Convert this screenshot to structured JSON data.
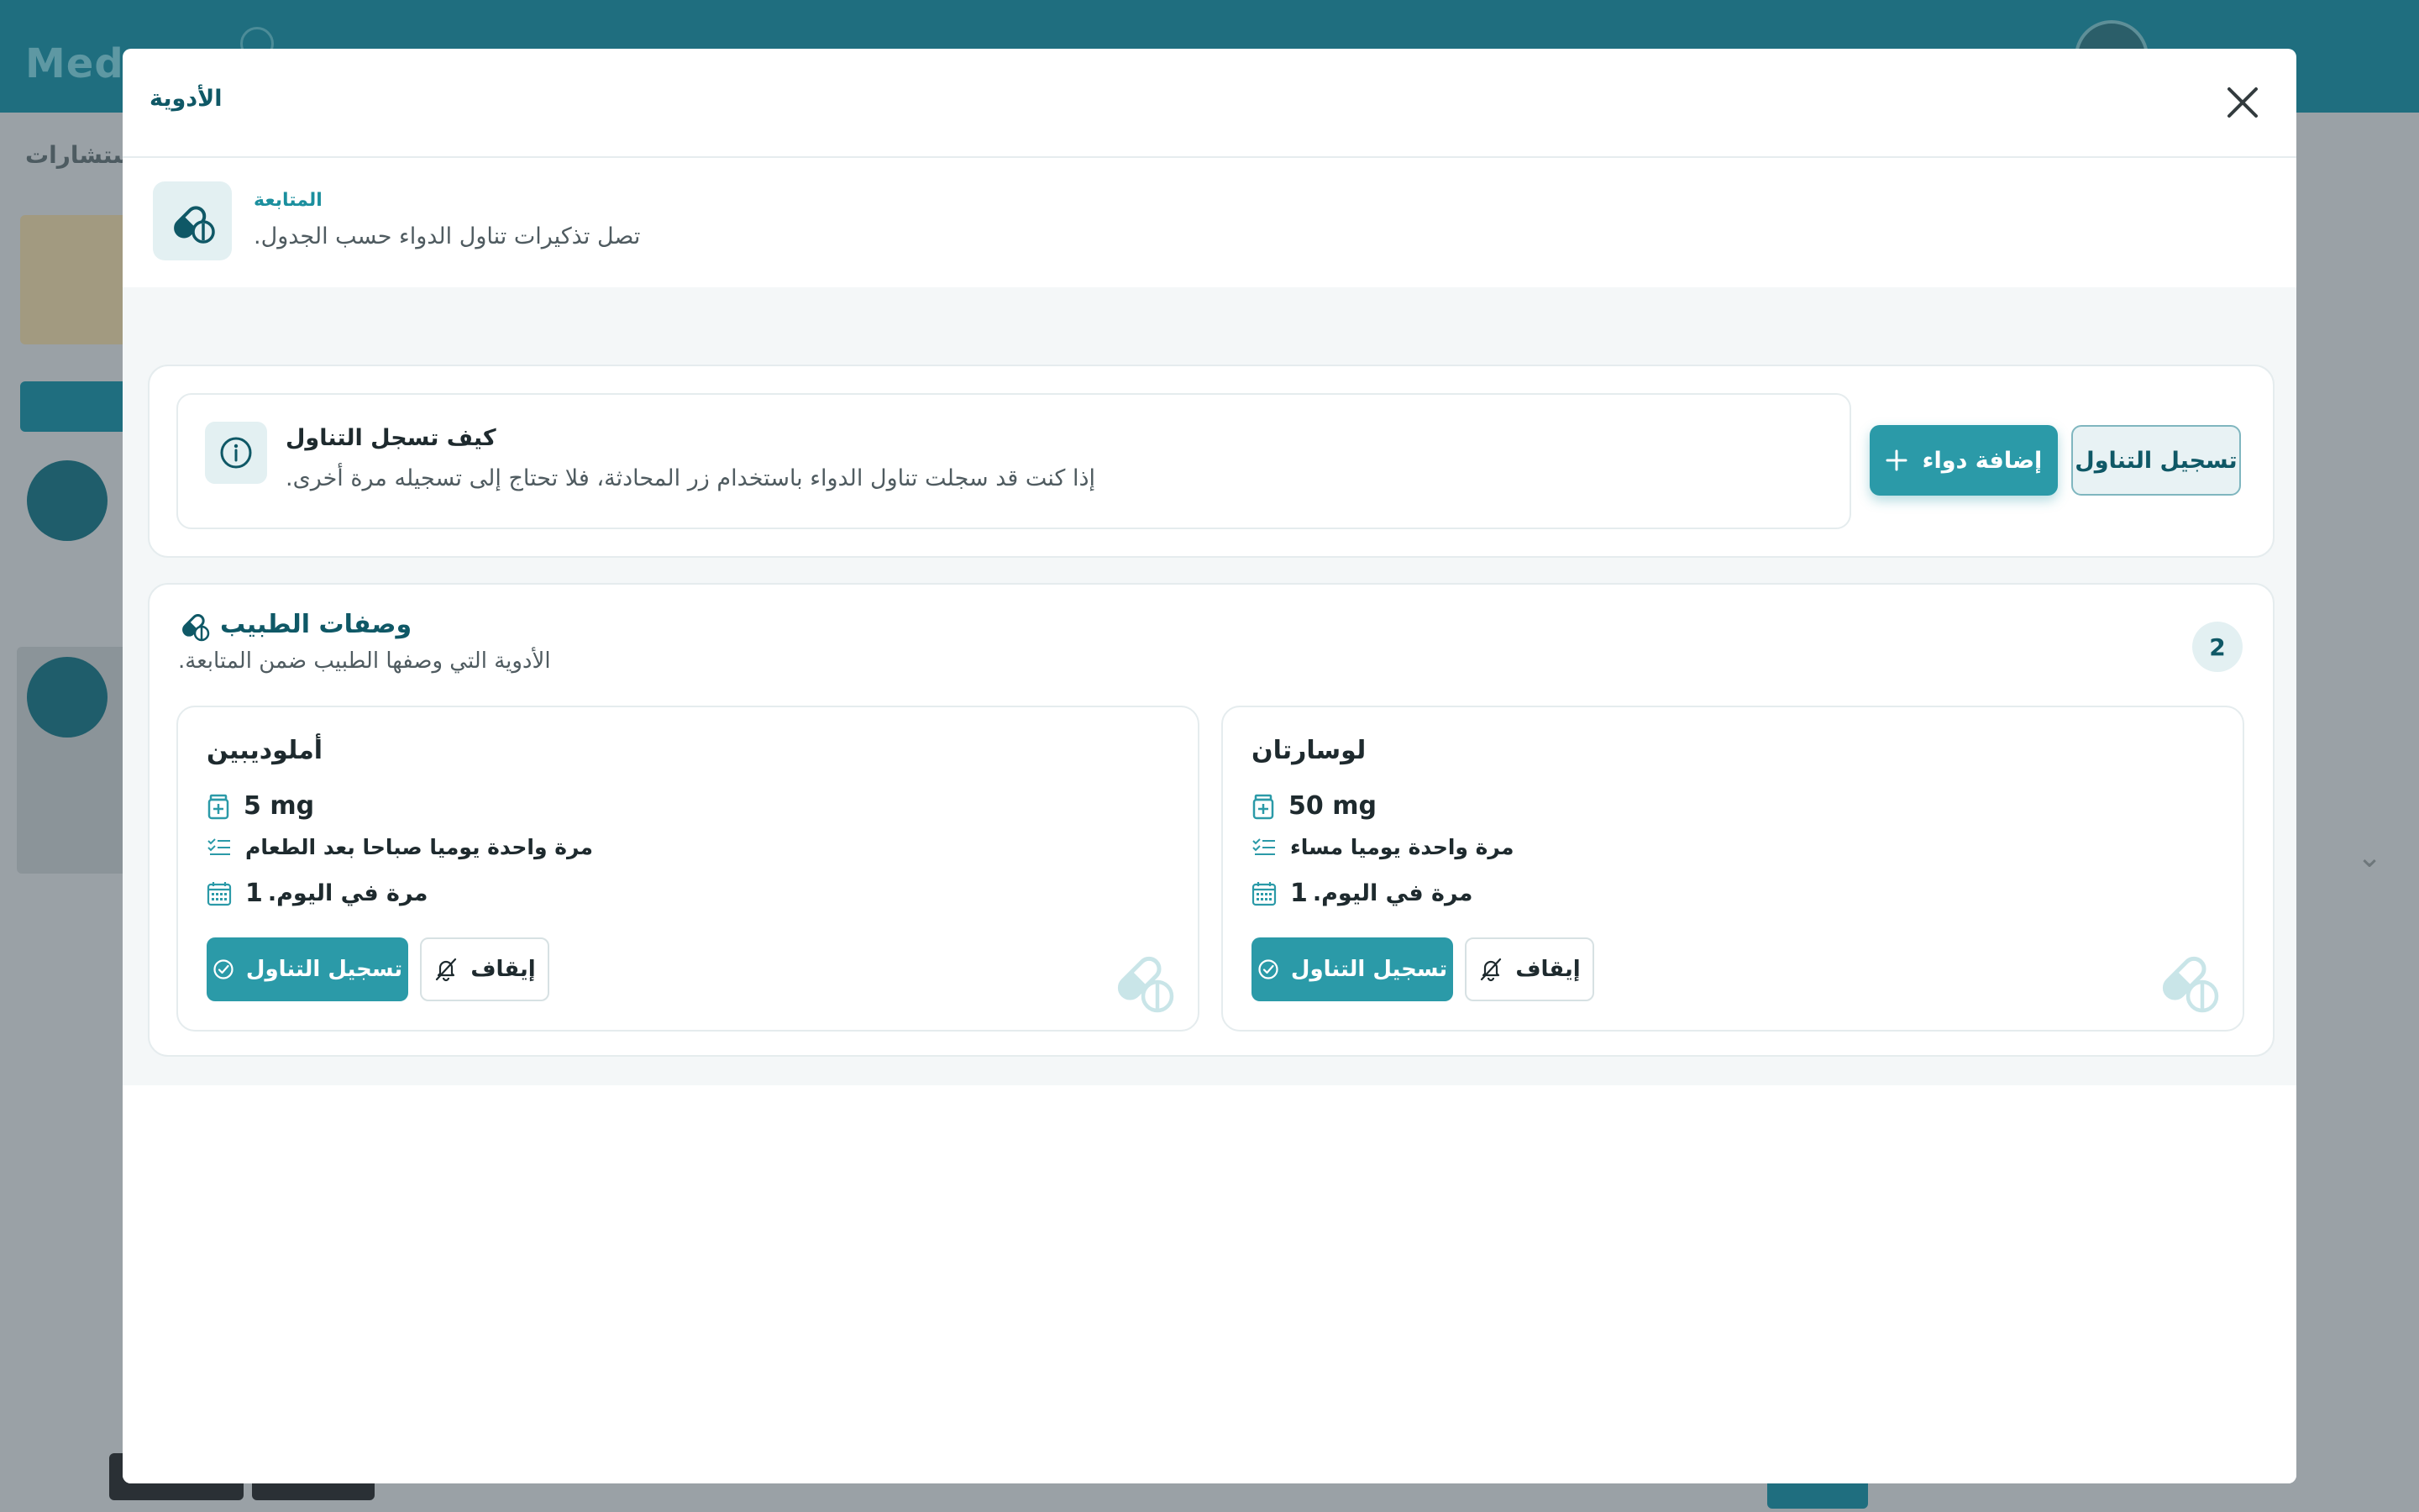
{
  "background": {
    "logo": "Meds",
    "nav_text": "استشارات"
  },
  "modal": {
    "title": "الأدوية",
    "tracking": {
      "label": "المتابعة",
      "description": "تصل تذكيرات تناول الدواء حسب الجدول."
    },
    "howto": {
      "title": "كيف تسجل التناول",
      "description": "إذا كنت قد سجلت تناول الدواء باستخدام زر المحادثة، فلا تحتاج إلى تسجيله مرة أخرى."
    },
    "actions": {
      "add_label": "إضافة دواء",
      "log_label": "تسجيل التناول"
    },
    "prescriptions": {
      "title": "وصفات الطبيب",
      "subtitle": "الأدوية التي وصفها الطبيب ضمن المتابعة.",
      "count": "2",
      "items": [
        {
          "name": "أملوديبين",
          "dose": "5 mg",
          "frequency": "مرة واحدة يوميا صباحا بعد الطعام",
          "times_count": "1",
          "times_text": "مرة في اليوم.",
          "log_label": "تسجيل التناول",
          "stop_label": "إيقاف"
        },
        {
          "name": "لوسارتان",
          "dose": "50 mg",
          "frequency": "مرة واحدة يوميا مساء",
          "times_count": "1",
          "times_text": "مرة في اليوم.",
          "log_label": "تسجيل التناول",
          "stop_label": "إيقاف"
        }
      ]
    }
  },
  "colors": {
    "primary": "#2b9aa8",
    "primary_dark": "#0f5866",
    "header_bg": "#1f6e7f",
    "soft_bg": "#e3f0f2"
  },
  "icons": {
    "close": "close-icon",
    "pill": "pill-icon",
    "info": "info-icon",
    "plus": "plus-icon",
    "dose": "medicine-bottle-icon",
    "frequency": "list-check-icon",
    "calendar": "calendar-icon",
    "check": "check-circle-icon",
    "bell_off": "bell-off-icon"
  }
}
